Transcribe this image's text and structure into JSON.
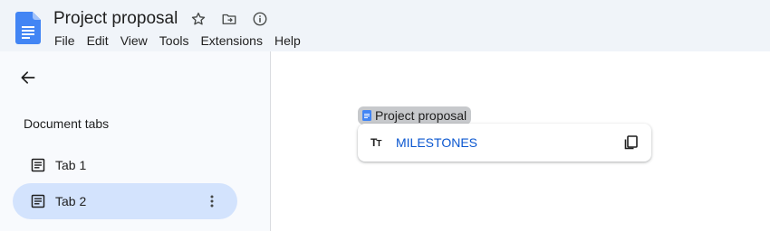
{
  "header": {
    "title": "Project proposal",
    "menu": [
      "File",
      "Edit",
      "View",
      "Tools",
      "Extensions",
      "Help"
    ]
  },
  "sidebar": {
    "section_title": "Document tabs",
    "tabs": [
      {
        "label": "Tab 1",
        "selected": false
      },
      {
        "label": "Tab 2",
        "selected": true
      }
    ]
  },
  "main": {
    "chip_label": "Project proposal",
    "heading_link": "MILESTONES"
  },
  "colors": {
    "header_bg": "#f0f4f9",
    "selected_tab_bg": "#d3e3fd",
    "link": "#0b57d0",
    "docs_blue": "#4285f4"
  }
}
